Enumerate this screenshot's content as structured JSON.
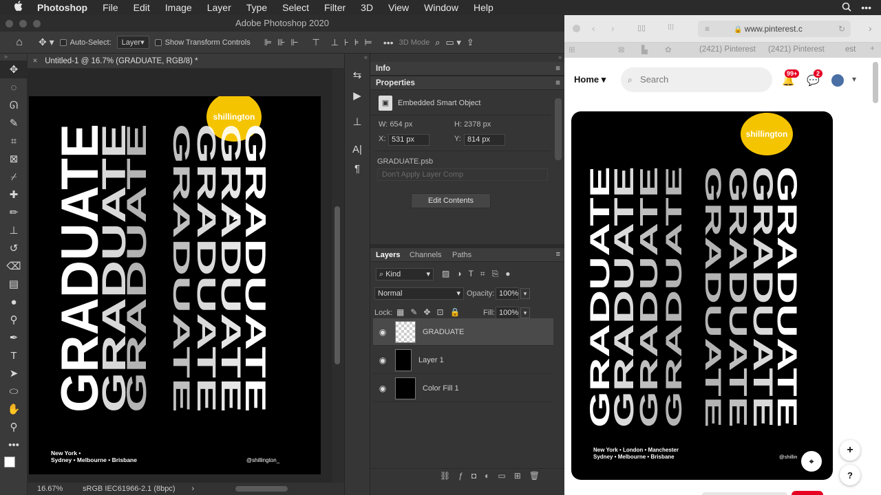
{
  "menubar": {
    "apple": "",
    "app": "Photoshop",
    "items": [
      "File",
      "Edit",
      "Image",
      "Layer",
      "Type",
      "Select",
      "Filter",
      "3D",
      "View",
      "Window",
      "Help"
    ]
  },
  "photoshop": {
    "window_title": "Adobe Photoshop 2020",
    "options": {
      "auto_select_label": "Auto-Select:",
      "auto_select_value": "Layer",
      "show_transform": "Show Transform Controls",
      "three_d_mode": "3D Mode"
    },
    "doc_tab": "Untitled-1 @ 16.7% (GRADUATE, RGB/8) *",
    "status": {
      "zoom": "16.67%",
      "profile": "sRGB IEC61966-2.1 (8bpc)"
    },
    "poster": {
      "badge": "shillington",
      "word": "GRADUATE",
      "cities_line1": "New York  •",
      "cities_line2": "Sydney  •  Melbourne  •  Brisbane",
      "handle": "@shillington_"
    },
    "info_panel": {
      "title": "Info"
    },
    "properties": {
      "title": "Properties",
      "type": "Embedded Smart Object",
      "w_label": "W:",
      "w_value": "654 px",
      "h_label": "H:",
      "h_value": "2378 px",
      "x_label": "X:",
      "x_value": "531 px",
      "y_label": "Y:",
      "y_value": "814 px",
      "file": "GRADUATE.psb",
      "layer_comp": "Don't Apply Layer Comp",
      "edit_button": "Edit Contents"
    },
    "layers_panel": {
      "tabs": [
        "Layers",
        "Channels",
        "Paths"
      ],
      "filter": "Kind",
      "blend_mode": "Normal",
      "opacity_label": "Opacity:",
      "opacity_value": "100%",
      "lock_label": "Lock:",
      "fill_label": "Fill:",
      "fill_value": "100%",
      "layers": [
        {
          "name": "GRADUATE",
          "selected": true
        },
        {
          "name": "Layer 1",
          "selected": false
        },
        {
          "name": "Color Fill 1",
          "selected": false
        }
      ]
    }
  },
  "browser": {
    "url": "www.pinterest.c",
    "tabs": [
      "(2421) Pinterest",
      "(2421) Pinterest",
      "est"
    ],
    "home_label": "Home",
    "search_placeholder": "Search",
    "notif_badge": "99+",
    "msg_badge": "2",
    "pin": {
      "badge": "shillington",
      "cities_line1": "New York  •  London  •  Manchester",
      "cities_line2": "Sydney  •  Melbourne  •  Brisbane",
      "handle": "@shillin"
    },
    "plus": "+",
    "help": "?"
  },
  "colors": {
    "badge_yellow": "#f5c400",
    "pinterest_red": "#e60023",
    "ps_selected": "#4a4a4a"
  }
}
